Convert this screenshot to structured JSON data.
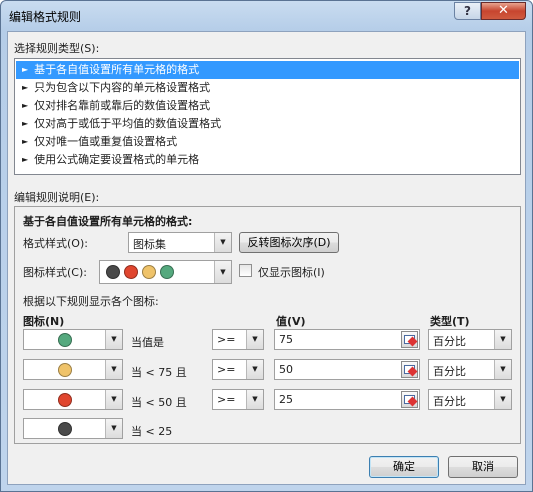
{
  "window": {
    "title": "编辑格式规则",
    "help_glyph": "?",
    "close_glyph": "✕"
  },
  "rule_type": {
    "label": "选择规则类型(S):",
    "items": [
      "基于各自值设置所有单元格的格式",
      "只为包含以下内容的单元格设置格式",
      "仅对排名靠前或靠后的数值设置格式",
      "仅对高于或低于平均值的数值设置格式",
      "仅对唯一值或重复值设置格式",
      "使用公式确定要设置格式的单元格"
    ],
    "selected_index": 0
  },
  "rule_desc": {
    "label": "编辑规则说明(E):",
    "heading": "基于各自值设置所有单元格的格式:",
    "format_style_label": "格式样式(O):",
    "format_style_value": "图标集",
    "reverse_order_button": "反转图标次序(D)",
    "icon_style_label": "图标样式(C):",
    "icon_style_colors": [
      "#4a4a4a",
      "#e0462f",
      "#efc36a",
      "#55a97e"
    ],
    "show_icon_only_label": "仅显示图标(I)",
    "show_icon_only_checked": false,
    "rules_caption": "根据以下规则显示各个图标:",
    "col_icon": "图标(N)",
    "col_value": "值(V)",
    "col_type": "类型(T)",
    "rows": [
      {
        "icon_color": "#55a97e",
        "condition": "当值是",
        "operator": ">=",
        "value": "75",
        "type": "百分比"
      },
      {
        "icon_color": "#efc36a",
        "condition": "当 < 75 且",
        "operator": ">=",
        "value": "50",
        "type": "百分比"
      },
      {
        "icon_color": "#e0462f",
        "condition": "当 < 50 且",
        "operator": ">=",
        "value": "25",
        "type": "百分比"
      },
      {
        "icon_color": "#4a4a4a",
        "condition": "当 < 25"
      }
    ]
  },
  "footer": {
    "ok": "确定",
    "cancel": "取消"
  }
}
